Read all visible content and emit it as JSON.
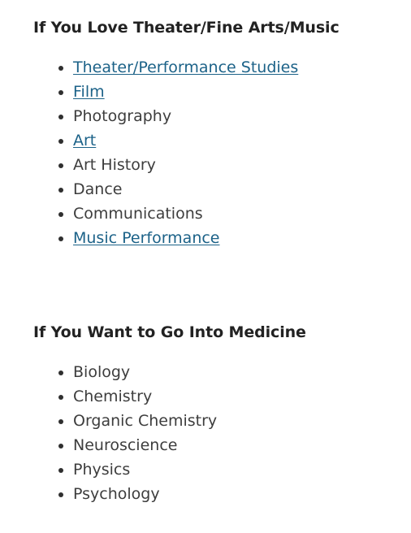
{
  "page": {
    "background_color": "#ffffff",
    "text_color": "#3d3d3d",
    "heading_color": "#222222",
    "link_color": "#1c6288"
  },
  "sections": [
    {
      "id": "arts",
      "heading": "If You Love Theater/Fine Arts/Music",
      "items": [
        {
          "label": "Theater/Performance Studies",
          "is_link": true
        },
        {
          "label": "Film",
          "is_link": true
        },
        {
          "label": "Photography",
          "is_link": false
        },
        {
          "label": "Art",
          "is_link": true
        },
        {
          "label": "Art History",
          "is_link": false
        },
        {
          "label": "Dance",
          "is_link": false
        },
        {
          "label": "Communications",
          "is_link": false
        },
        {
          "label": "Music Performance",
          "is_link": true
        }
      ]
    },
    {
      "id": "medicine",
      "heading": "If You Want to Go Into Medicine",
      "items": [
        {
          "label": "Biology",
          "is_link": false
        },
        {
          "label": "Chemistry",
          "is_link": false
        },
        {
          "label": "Organic Chemistry",
          "is_link": false
        },
        {
          "label": "Neuroscience",
          "is_link": false
        },
        {
          "label": "Physics",
          "is_link": false
        },
        {
          "label": "Psychology",
          "is_link": false
        }
      ]
    }
  ]
}
